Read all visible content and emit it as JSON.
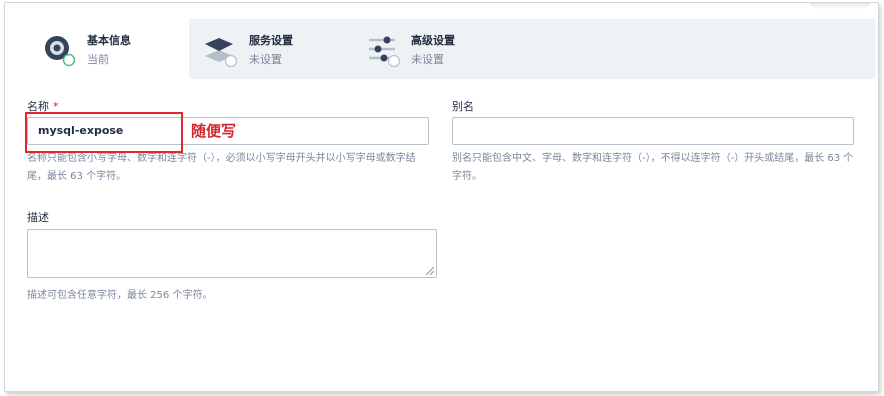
{
  "steps": [
    {
      "title": "基本信息",
      "status": "当前",
      "icon": "basic-info-icon"
    },
    {
      "title": "服务设置",
      "status": "未设置",
      "icon": "service-settings-icon"
    },
    {
      "title": "高级设置",
      "status": "未设置",
      "icon": "advanced-settings-icon"
    }
  ],
  "form": {
    "name": {
      "label": "名称",
      "required_mark": "*",
      "value": "mysql-expose",
      "hint": "名称只能包含小写字母、数字和连字符（-），必须以小写字母开头并以小写字母或数字结尾，最长 63 个字符。"
    },
    "alias": {
      "label": "别名",
      "value": "",
      "hint": "别名只能包含中文、字母、数字和连字符（-），不得以连字符（-）开头或结尾，最长 63 个字符。"
    },
    "description": {
      "label": "描述",
      "value": "",
      "hint": "描述可包含任意字符，最长 256 个字符。"
    }
  },
  "annotation": {
    "text": "随便写",
    "color": "#d3272e"
  },
  "colors": {
    "accent": "#55bc8a",
    "text": "#242e42",
    "muted": "#79879c",
    "step_bar": "#eef2f5"
  }
}
